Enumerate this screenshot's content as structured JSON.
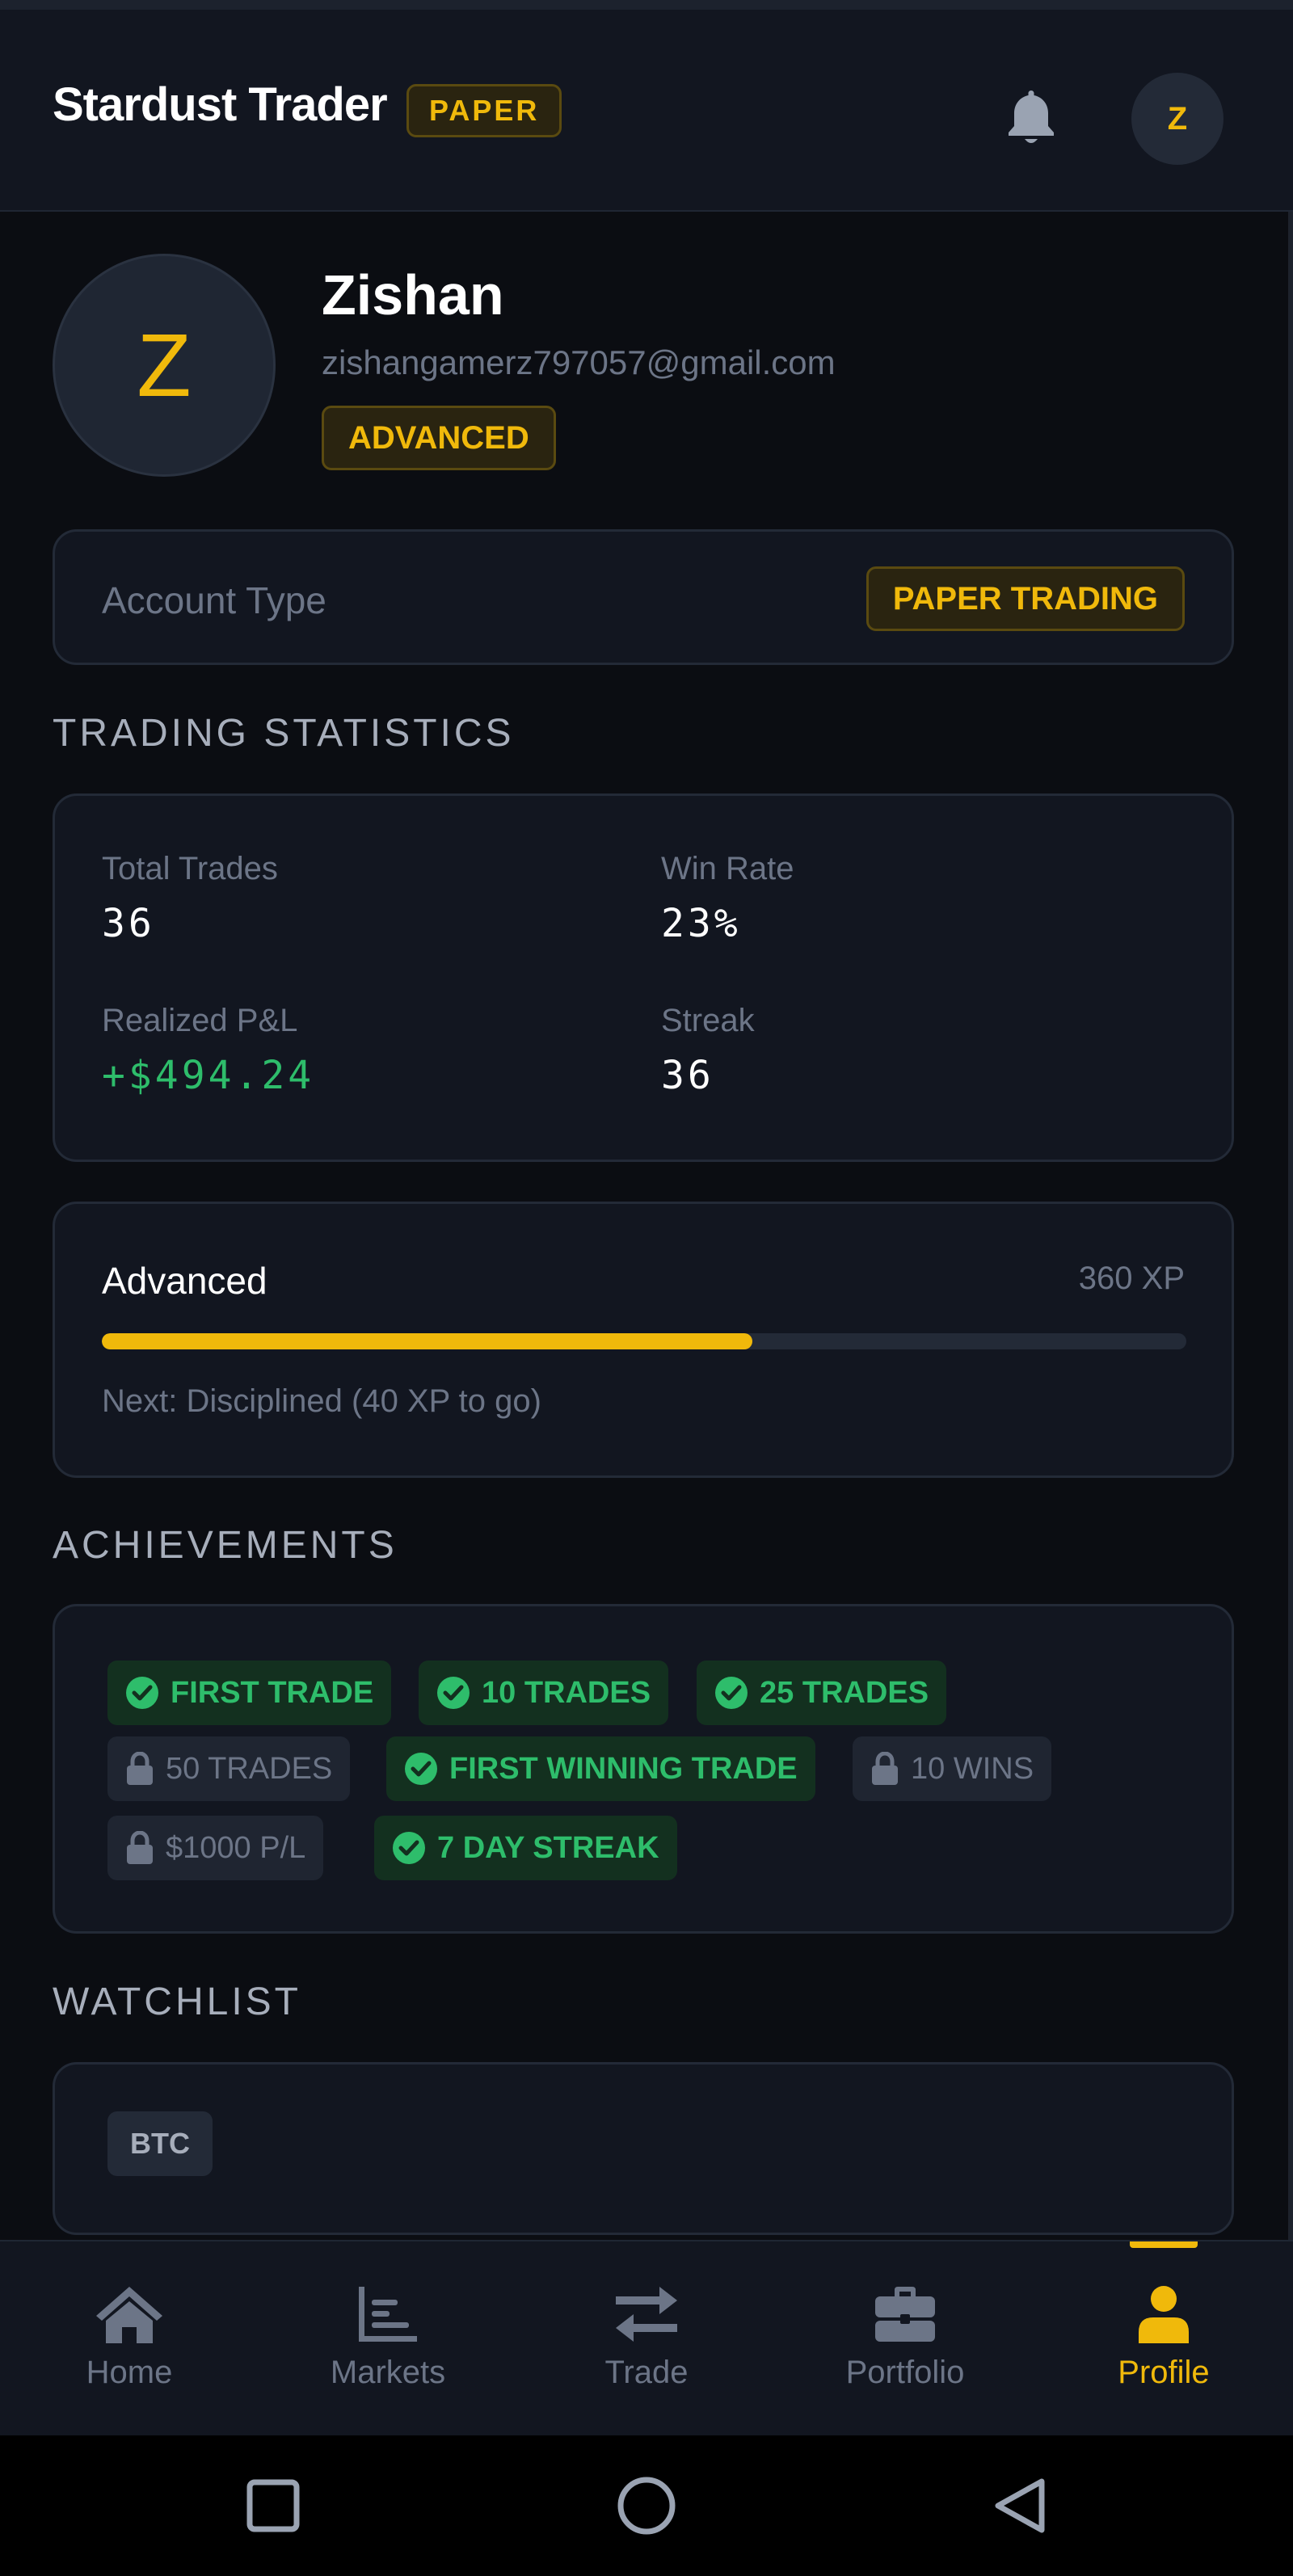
{
  "header": {
    "title": "Stardust Trader",
    "mode_badge": "PAPER",
    "avatar_initial": "Z"
  },
  "profile": {
    "initial": "Z",
    "name": "Zishan",
    "email": "zishangamerz797057@gmail.com",
    "level_badge": "ADVANCED"
  },
  "account": {
    "label": "Account Type",
    "value": "PAPER TRADING"
  },
  "stats": {
    "section_title": "TRADING STATISTICS",
    "items": [
      {
        "label": "Total Trades",
        "value": "36"
      },
      {
        "label": "Win Rate",
        "value": "23%"
      },
      {
        "label": "Realized P&L",
        "value": "+$494.24"
      },
      {
        "label": "Streak",
        "value": "36"
      }
    ]
  },
  "level": {
    "name": "Advanced",
    "xp": "360 XP",
    "progress_percent": 60,
    "next": "Next: Disciplined (40 XP to go)"
  },
  "achievements": {
    "section_title": "ACHIEVEMENTS",
    "items": [
      {
        "label": "FIRST TRADE",
        "earned": true
      },
      {
        "label": "10 TRADES",
        "earned": true
      },
      {
        "label": "25 TRADES",
        "earned": true
      },
      {
        "label": "50 TRADES",
        "earned": false
      },
      {
        "label": "FIRST WINNING TRADE",
        "earned": true
      },
      {
        "label": "10 WINS",
        "earned": false
      },
      {
        "label": "$1000 P/L",
        "earned": false
      },
      {
        "label": "7 DAY STREAK",
        "earned": true
      }
    ]
  },
  "watchlist": {
    "section_title": "WATCHLIST",
    "items": [
      "BTC"
    ]
  },
  "nav": {
    "items": [
      {
        "label": "Home",
        "icon": "home-icon"
      },
      {
        "label": "Markets",
        "icon": "chart-bars-icon"
      },
      {
        "label": "Trade",
        "icon": "swap-arrows-icon"
      },
      {
        "label": "Portfolio",
        "icon": "briefcase-icon"
      },
      {
        "label": "Profile",
        "icon": "user-icon"
      }
    ],
    "active": "Profile"
  },
  "colors": {
    "accent": "#f0b90b",
    "positive": "#2ebd6b",
    "background": "#0b0d12",
    "card": "#121620",
    "muted": "#6c7587"
  }
}
